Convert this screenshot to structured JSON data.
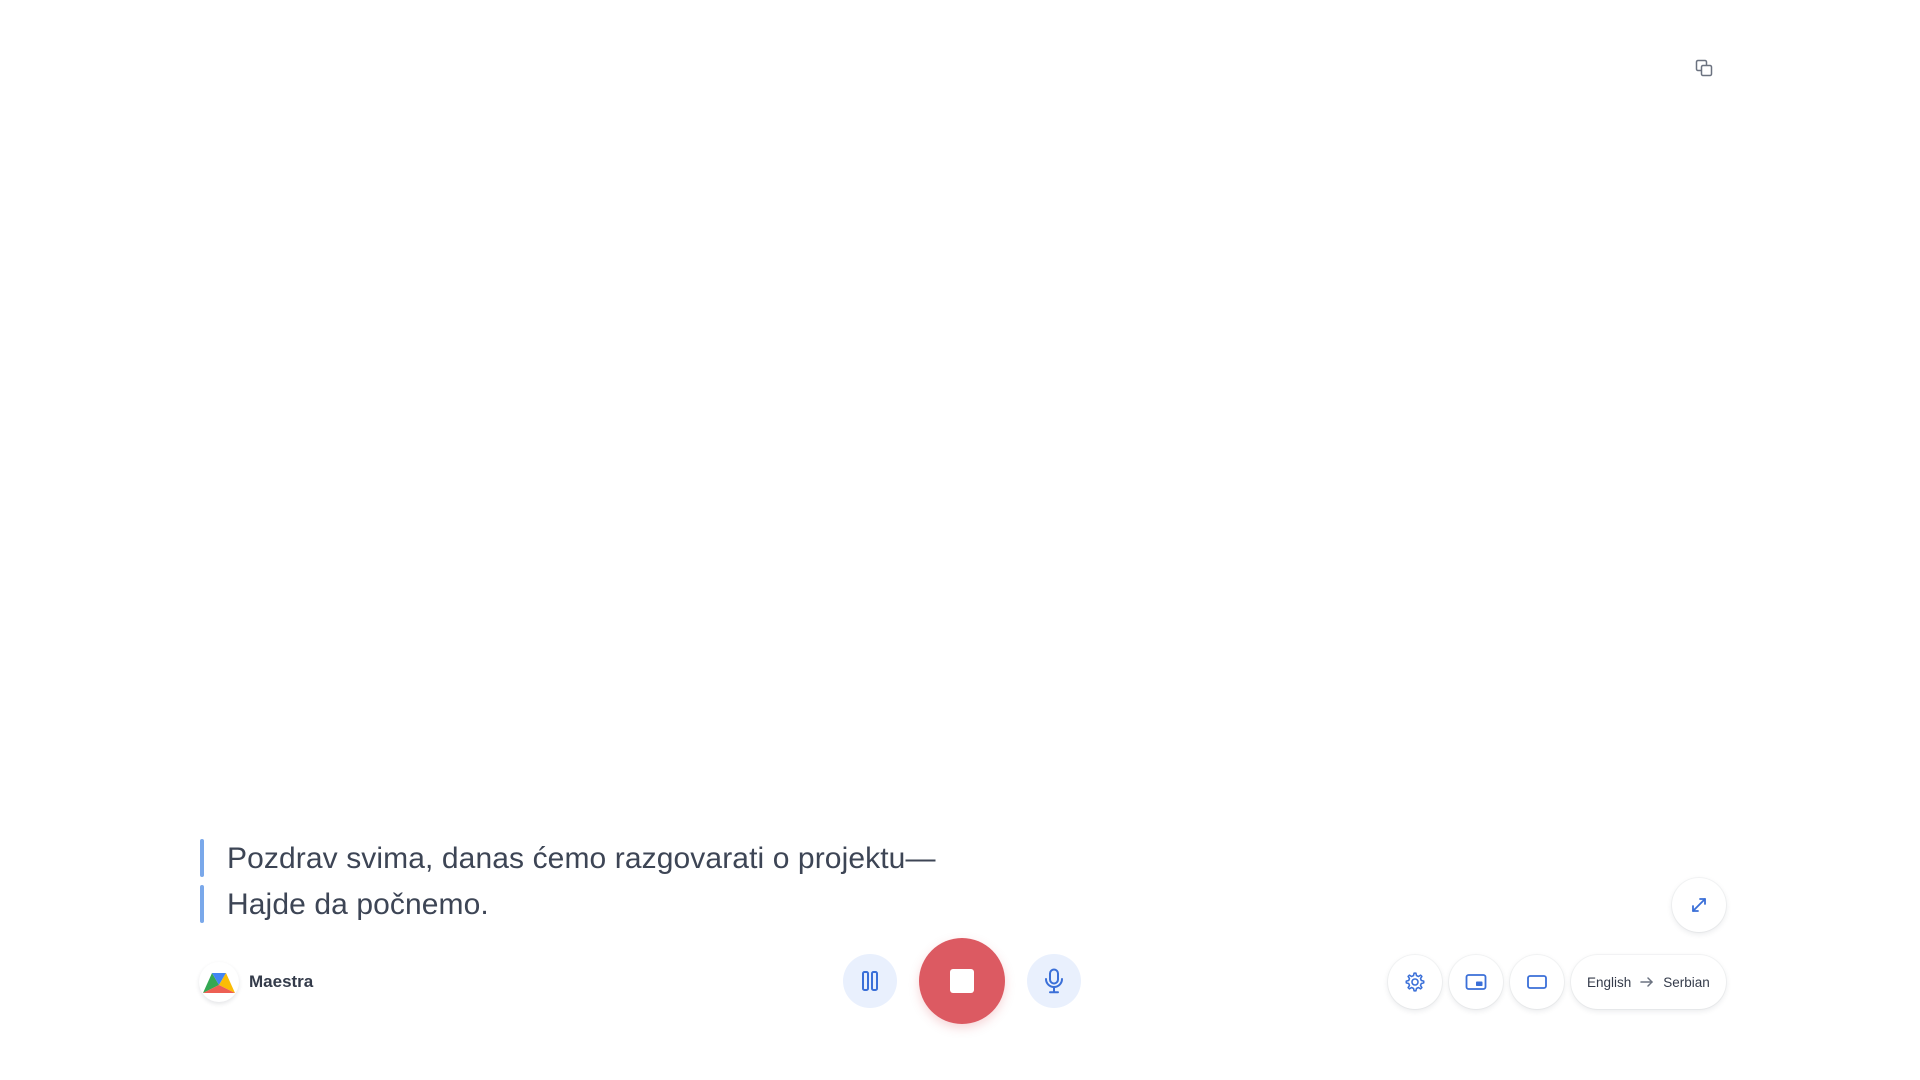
{
  "transcript": {
    "lines": [
      "Pozdrav svima, danas ćemo razgovarati o projektu—",
      "Hajde da počnemo."
    ]
  },
  "brand": {
    "name": "Maestra",
    "logo_icon": "maestra-logo-icon"
  },
  "controls": {
    "pause_icon": "pause-icon",
    "stop_icon": "stop-icon",
    "mic_icon": "microphone-icon"
  },
  "tools": {
    "settings_icon": "gear-icon",
    "pip_icon": "picture-in-picture-icon",
    "window_icon": "window-icon",
    "expand_icon": "expand-icon",
    "copy_icon": "copy-icon"
  },
  "language": {
    "source": "English",
    "target": "Serbian"
  },
  "colors": {
    "accent_blue": "#3a6fd8",
    "stop_red": "#dc5a62",
    "control_bg": "#e9f0fd",
    "transcript_bar": "#7aa8ea",
    "text": "#3d4555"
  }
}
